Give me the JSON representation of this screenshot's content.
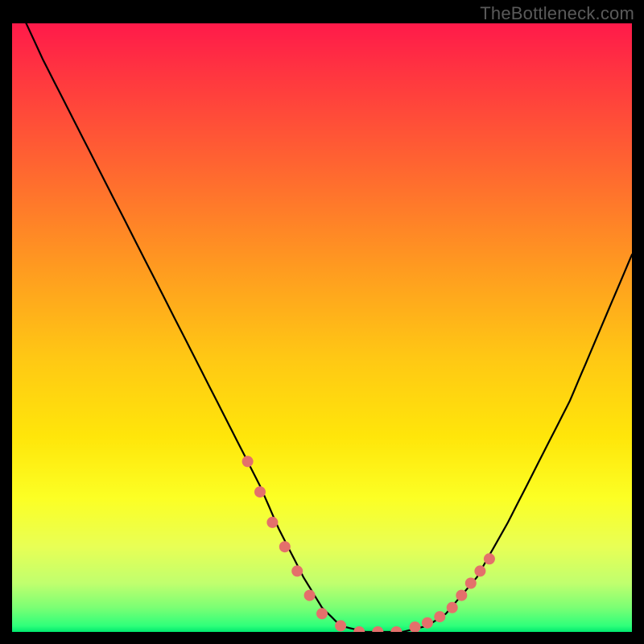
{
  "watermark": "TheBottleneck.com",
  "chart_data": {
    "type": "line",
    "title": "",
    "xlabel": "",
    "ylabel": "",
    "xlim": [
      0,
      100
    ],
    "ylim": [
      0,
      100
    ],
    "series": [
      {
        "name": "bottleneck-curve",
        "x": [
          0,
          5,
          10,
          15,
          20,
          25,
          30,
          35,
          40,
          43,
          47,
          50,
          53,
          57,
          60,
          63,
          67,
          70,
          75,
          80,
          85,
          90,
          95,
          100
        ],
        "values": [
          105,
          94,
          84,
          74,
          64,
          54,
          44,
          34,
          24,
          17,
          9,
          4,
          1,
          0,
          0,
          0,
          1,
          3,
          9,
          18,
          28,
          38,
          50,
          62
        ]
      }
    ],
    "markers": {
      "name": "highlight-dots",
      "x": [
        38,
        40,
        42,
        44,
        46,
        48,
        50,
        53,
        56,
        59,
        62,
        65,
        67,
        69,
        71,
        72.5,
        74,
        75.5,
        77
      ],
      "values": [
        28,
        23,
        18,
        14,
        10,
        6,
        3,
        1,
        0,
        0,
        0,
        0.8,
        1.5,
        2.5,
        4,
        6,
        8,
        10,
        12
      ]
    }
  }
}
